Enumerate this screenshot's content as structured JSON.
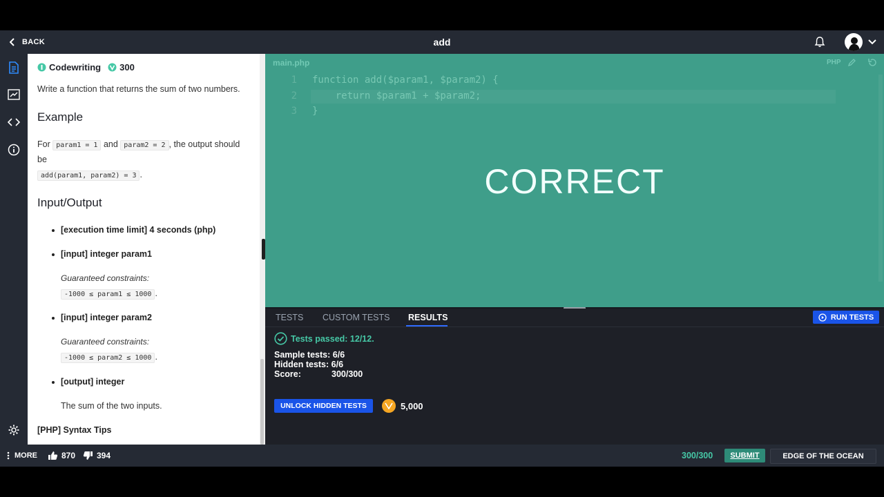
{
  "header": {
    "back_label": "BACK",
    "title": "add"
  },
  "task": {
    "type_label": "Codewriting",
    "points": "300",
    "statement": "Write a function that returns the sum of two numbers.",
    "example_heading": "Example",
    "example_for": "For",
    "example_and": "and",
    "example_param1": "param1 = 1",
    "example_param2": "param2 = 2",
    "example_output_text": ", the output should",
    "example_be": "be",
    "example_result": "add(param1, param2) = 3",
    "example_period": ".",
    "io_heading": "Input/Output",
    "io_items": [
      "[execution time limit] 4 seconds (php)",
      "[input] integer param1",
      "[input] integer param2",
      "[output] integer"
    ],
    "constraints_label": "Guaranteed constraints:",
    "constraint1": "-1000 ≤ param1 ≤ 1000",
    "constraint2": "-1000 ≤ param2 ≤ 1000",
    "output_desc": "The sum of the two inputs.",
    "syntax_tips": "[PHP] Syntax Tips"
  },
  "editor": {
    "file_name": "main.php",
    "language": "PHP",
    "line_numbers": [
      "1",
      "2",
      "3"
    ],
    "lines": [
      "function add($param1, $param2) {",
      "    return $param1 + $param2;",
      "}"
    ],
    "overlay_text": "CORRECT"
  },
  "results": {
    "tabs": [
      "TESTS",
      "CUSTOM TESTS",
      "RESULTS"
    ],
    "active_tab": "RESULTS",
    "run_label": "RUN TESTS",
    "passed_label": "Tests passed: 12/12.",
    "sample_label": "Sample tests:",
    "sample_value": "6/6",
    "hidden_label": "Hidden tests:",
    "hidden_value": "6/6",
    "score_label": "Score:",
    "score_value": "300/300",
    "unlock_label": "UNLOCK HIDDEN TESTS",
    "coins": "5,000"
  },
  "footer": {
    "more_label": "MORE",
    "upvotes": "870",
    "downvotes": "394",
    "score": "300/300",
    "submit_label": "SUBMIT",
    "arcade_label": "EDGE OF THE OCEAN"
  },
  "colors": {
    "accent": "#1a54e8",
    "success": "#46c8a6",
    "editor_bg": "#3f9e8a",
    "panel_bg": "#1e2027"
  }
}
